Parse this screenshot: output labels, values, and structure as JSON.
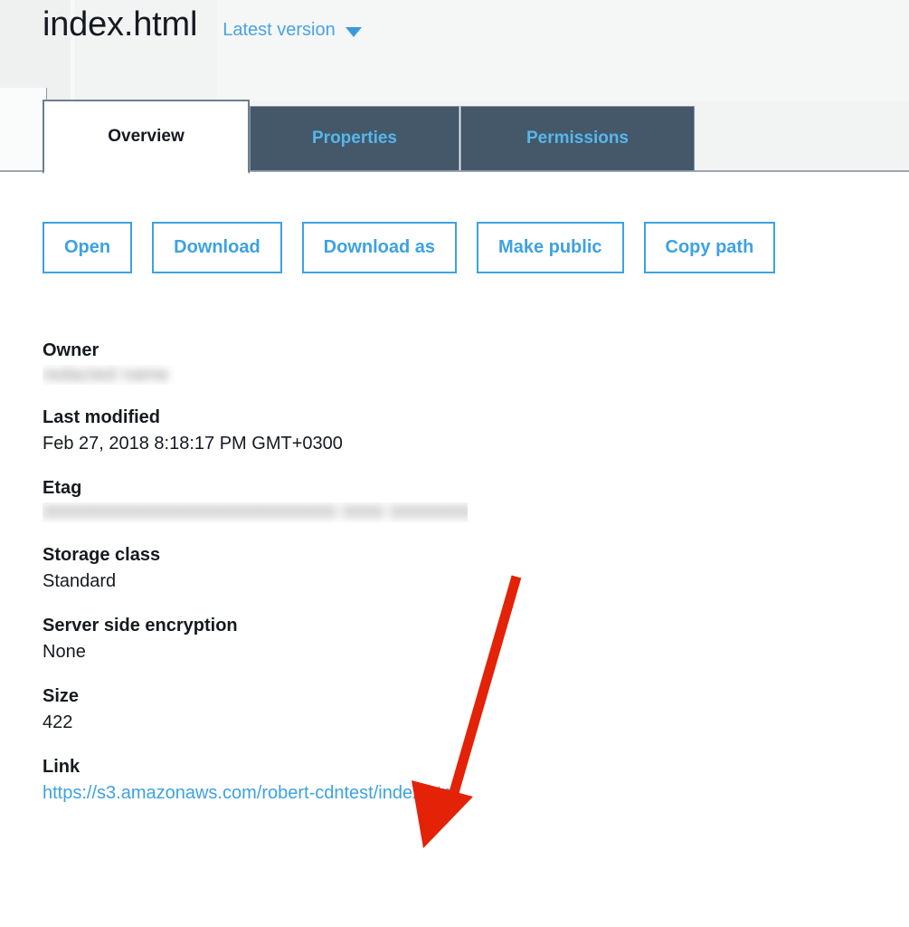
{
  "header": {
    "file_name": "index.html",
    "version_label": "Latest version",
    "version_caret_icon": "chevron-down-icon"
  },
  "tabs": [
    {
      "id": "overview",
      "label": "Overview",
      "active": true
    },
    {
      "id": "properties",
      "label": "Properties",
      "active": false
    },
    {
      "id": "permissions",
      "label": "Permissions",
      "active": false
    }
  ],
  "actions": [
    {
      "id": "open",
      "label": "Open"
    },
    {
      "id": "download",
      "label": "Download"
    },
    {
      "id": "download-as",
      "label": "Download as"
    },
    {
      "id": "make-public",
      "label": "Make public"
    },
    {
      "id": "copy-path",
      "label": "Copy path"
    }
  ],
  "metadata": {
    "owner": {
      "label": "Owner",
      "value": "redacted name",
      "redacted": true
    },
    "last_modified": {
      "label": "Last modified",
      "value": "Feb 27, 2018 8:18:17 PM GMT+0300",
      "redacted": false
    },
    "etag": {
      "label": "Etag",
      "value": "0000000000000000000000000000 0000 00000000",
      "redacted": true
    },
    "storage_class": {
      "label": "Storage class",
      "value": "Standard",
      "redacted": false
    },
    "server_side_encryption": {
      "label": "Server side encryption",
      "value": "None",
      "redacted": false
    },
    "size": {
      "label": "Size",
      "value": "422",
      "redacted": false
    },
    "link": {
      "label": "Link",
      "value": "https://s3.amazonaws.com/robert-cdntest/index.html",
      "redacted": false
    }
  },
  "annotation": {
    "arrow_name": "red-annotation-arrow",
    "color": "#e32208",
    "points_to": "link-value"
  },
  "colors": {
    "accent_blue": "#3da2e0",
    "tab_inactive_bg": "#44586a",
    "tab_inactive_text": "#56b7ec",
    "chrome_bg": "#f2f3f3",
    "text": "#16191f",
    "annotation_red": "#e32208"
  }
}
